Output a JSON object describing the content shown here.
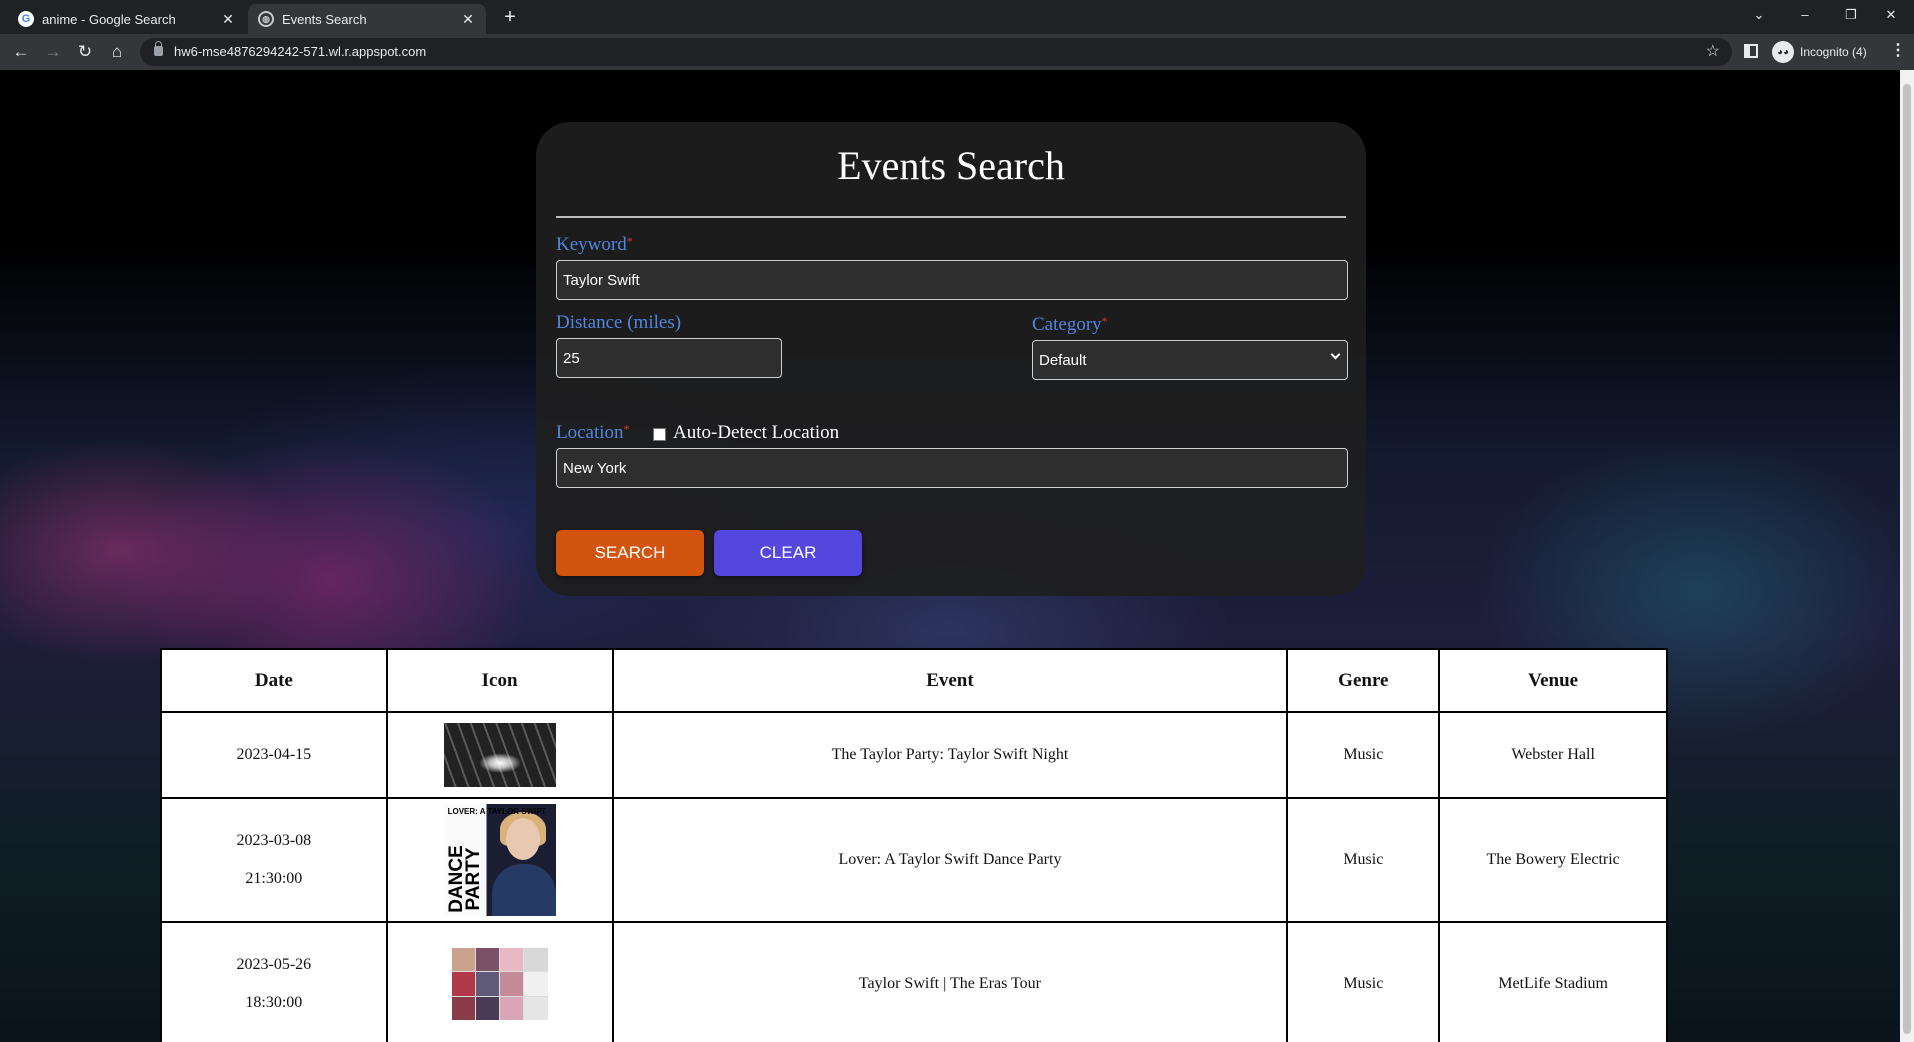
{
  "browser": {
    "tabs": [
      {
        "title": "anime - Google Search",
        "favicon": "google-icon",
        "active": false
      },
      {
        "title": "Events Search",
        "favicon": "globe-icon",
        "active": true
      }
    ],
    "url": "hw6-mse4876294242-571.wl.r.appspot.com",
    "profile_label": "Incognito (4)"
  },
  "form": {
    "title": "Events Search",
    "keyword": {
      "label": "Keyword",
      "value": "Taylor Swift"
    },
    "distance": {
      "label": "Distance (miles)",
      "value": "25"
    },
    "category": {
      "label": "Category",
      "value": "Default"
    },
    "location": {
      "label": "Location",
      "value": "New York",
      "autodetect_label": "Auto-Detect Location",
      "autodetect_checked": false
    },
    "search_label": "SEARCH",
    "clear_label": "CLEAR",
    "required_mark": "*"
  },
  "results": {
    "headers": [
      "Date",
      "Icon",
      "Event",
      "Genre",
      "Venue"
    ],
    "rows": [
      {
        "date": "2023-04-15",
        "time": "",
        "event": "The Taylor Party: Taylor Swift Night",
        "genre": "Music",
        "venue": "Webster Hall"
      },
      {
        "date": "2023-03-08",
        "time": "21:30:00",
        "event": "Lover: A Taylor Swift Dance Party",
        "genre": "Music",
        "venue": "The Bowery Electric",
        "icon_text": {
          "top": "LOVER: A TAYLOR SWIFT",
          "side": "DANCE PARTY"
        }
      },
      {
        "date": "2023-05-26",
        "time": "18:30:00",
        "event": "Taylor Swift | The Eras Tour",
        "genre": "Music",
        "venue": "MetLife Stadium"
      }
    ]
  },
  "colors": {
    "search_button": "#d2540e",
    "clear_button": "#5347de",
    "label": "#4f86e0",
    "required": "#e53935"
  }
}
